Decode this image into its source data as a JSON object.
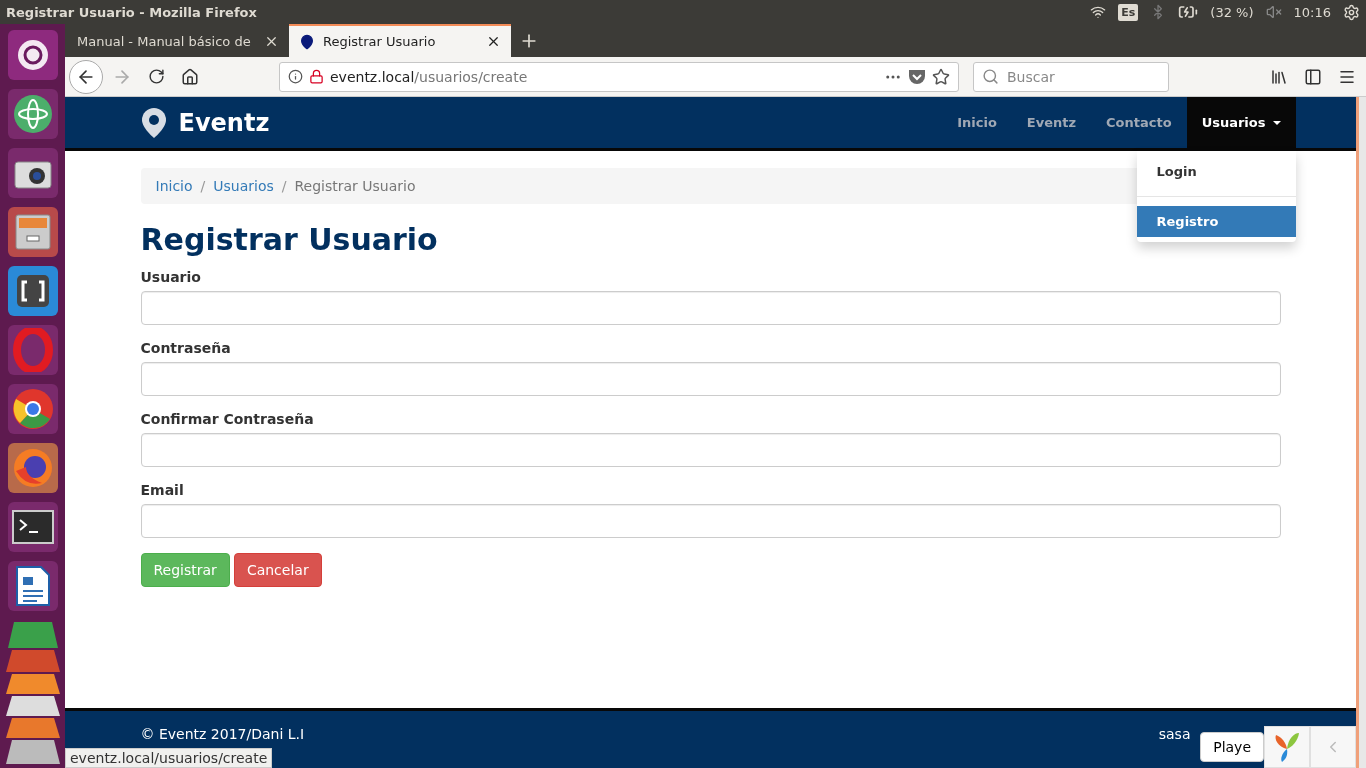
{
  "top_panel": {
    "title": "Registrar Usuario - Mozilla Firefox",
    "keyboard_layout": "Es",
    "battery": "(32 %)",
    "clock": "10:16"
  },
  "browser": {
    "tabs": [
      {
        "label": "Manual - Manual básico de",
        "selected": false
      },
      {
        "label": "Registrar Usuario",
        "selected": true
      }
    ],
    "url_host": "eventz.local",
    "url_path": "/usuarios/create",
    "search_placeholder": "Buscar"
  },
  "navbar": {
    "brand": "Eventz",
    "items": [
      {
        "label": "Inicio",
        "selected": false
      },
      {
        "label": "Eventz",
        "selected": false
      },
      {
        "label": "Contacto",
        "selected": false
      }
    ],
    "menu": {
      "label": "Usuarios",
      "selected": true,
      "expanded": true,
      "items": [
        {
          "label": "Login",
          "selected": false
        },
        {
          "label": "Registro",
          "selected": true
        }
      ]
    }
  },
  "breadcrumb": [
    {
      "label": "Inicio",
      "kind": "link"
    },
    {
      "separator": "/",
      "label": "Usuarios",
      "kind": "link"
    },
    {
      "separator": "/",
      "label": "Registrar Usuario",
      "kind": "current"
    }
  ],
  "heading": "Registrar Usuario",
  "fields": [
    {
      "label": "Usuario"
    },
    {
      "label": "Contraseña"
    },
    {
      "label": "Confirmar Contraseña"
    },
    {
      "label": "Email"
    }
  ],
  "buttons": [
    {
      "label": "Registrar",
      "kind": "success"
    },
    {
      "label": "Cancelar",
      "kind": "danger"
    }
  ],
  "footer": {
    "copyright": "© Eventz 2017/Dani L.I",
    "user": "sasa"
  },
  "status_link": "eventz.local/usuarios/create",
  "debug_toolbar": {
    "button": "Playe"
  }
}
